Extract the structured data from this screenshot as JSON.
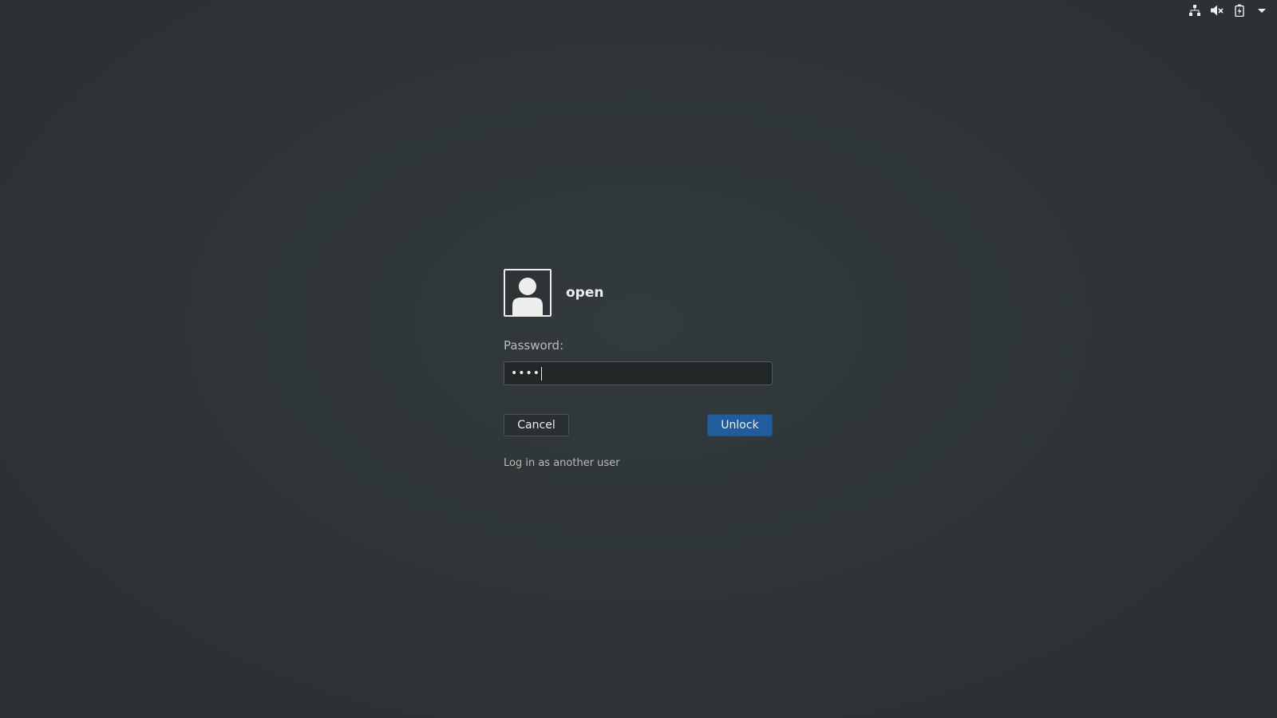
{
  "top_bar": {
    "icons": [
      "network-wired-icon",
      "volume-muted-icon",
      "battery-charging-icon",
      "system-menu-arrow-icon"
    ]
  },
  "unlock_dialog": {
    "user_name": "open",
    "avatar_icon": "user-avatar-icon",
    "password_label": "Password:",
    "password_value": "••••",
    "cancel_label": "Cancel",
    "unlock_label": "Unlock",
    "other_user_link": "Log in as another user"
  },
  "colors": {
    "background": "#2e3436",
    "accent": "#215d9c",
    "text": "#eeeeec"
  }
}
